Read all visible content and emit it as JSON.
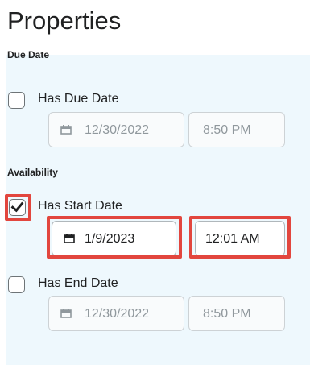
{
  "page": {
    "title": "Properties"
  },
  "due": {
    "section_label": "Due Date",
    "checkbox_label": "Has Due Date",
    "checked": false,
    "date_value": "12/30/2022",
    "time_value": "8:50 PM"
  },
  "availability": {
    "section_label": "Availability",
    "start": {
      "checkbox_label": "Has Start Date",
      "checked": true,
      "date_value": "1/9/2023",
      "time_value": "12:01 AM"
    },
    "end": {
      "checkbox_label": "Has End Date",
      "checked": false,
      "date_value": "12/30/2022",
      "time_value": "8:50 PM"
    }
  },
  "icons": {
    "date_field_icon": "calendar-icon",
    "checkmark_icon": "checkmark-icon"
  },
  "colors": {
    "highlight": "#e2463e",
    "panel_bg": "#eef8fd"
  }
}
